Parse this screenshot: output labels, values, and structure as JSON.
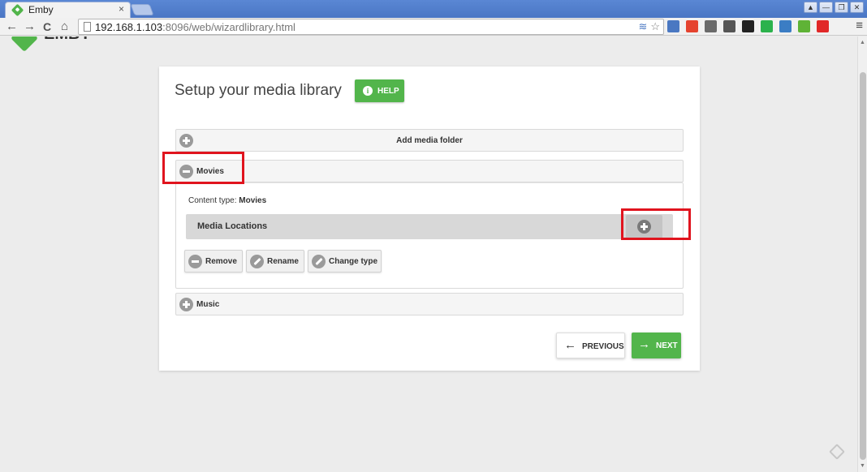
{
  "browser": {
    "tab_title": "Emby",
    "tab_close": "×",
    "url_host": "192.168.1.103",
    "url_rest": ":8096/web/wizardlibrary.html",
    "window_controls": [
      "▲",
      "—",
      "❐",
      "✕"
    ]
  },
  "nav": {
    "back": "←",
    "forward": "→",
    "reload": "C",
    "home": "⌂",
    "menu": "≡"
  },
  "extensions": [
    {
      "name": "translate-ext-icon",
      "color": "#4a78c2"
    },
    {
      "name": "chrome-ext-icon",
      "color": "#e5432f"
    },
    {
      "name": "screen-ext-icon",
      "color": "#6a6a6a"
    },
    {
      "name": "wrench-ext-icon",
      "color": "#555555"
    },
    {
      "name": "layers-ext-icon",
      "color": "#222222"
    },
    {
      "name": "feedly-ext-icon",
      "color": "#2bb24c"
    },
    {
      "name": "s-ext-icon",
      "color": "#3b7dc4"
    },
    {
      "name": "download-ext-icon",
      "color": "#5fb336"
    },
    {
      "name": "flipboard-ext-icon",
      "color": "#e12828"
    }
  ],
  "page": {
    "logo_text": "EMBY",
    "title": "Setup your media library",
    "help_label": "HELP",
    "add_folder_label": "Add media folder",
    "movies_label": "Movies",
    "content_type_label": "Content type: ",
    "content_type_value": "Movies",
    "media_locations_label": "Media Locations",
    "actions": {
      "remove": "Remove",
      "rename": "Rename",
      "change_type": "Change type"
    },
    "music_label": "Music",
    "previous_label": "PREVIOUS",
    "next_label": "NEXT"
  },
  "colors": {
    "accent": "#52b54b",
    "highlight": "#e0141e"
  }
}
